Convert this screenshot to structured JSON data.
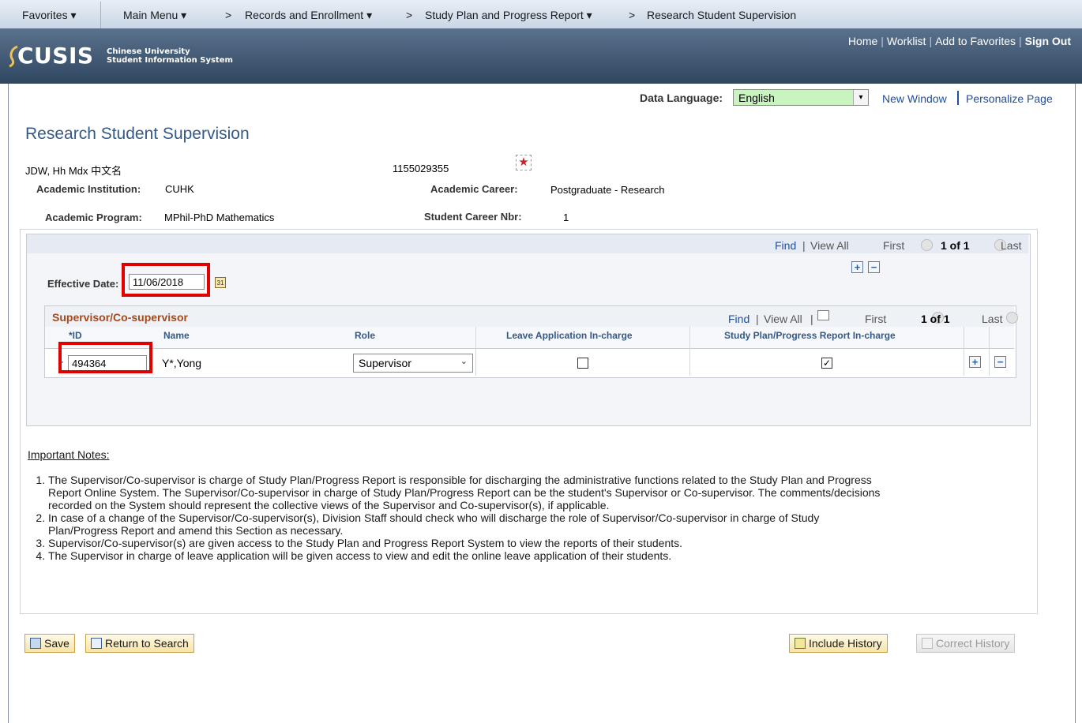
{
  "nav": {
    "favorites": "Favorites ▾",
    "main_menu": "Main Menu ▾",
    "crumbs": [
      "Records and Enrollment ▾",
      "Study Plan and Progress Report ▾",
      "Research Student Supervision"
    ],
    "sep": ">"
  },
  "header": {
    "logo_text": "CUSIS",
    "logo_sub1": "Chinese University",
    "logo_sub2": "Student Information System",
    "links": {
      "home": "Home",
      "worklist": "Worklist",
      "add_fav": "Add to Favorites",
      "signout": "Sign Out"
    }
  },
  "toolbar": {
    "data_language_label": "Data Language:",
    "data_language_value": "English",
    "new_window": "New Window",
    "personalize": "Personalize Page"
  },
  "page": {
    "title": "Research Student Supervision",
    "student_name": "JDW, Hh Mdx 中文名",
    "student_id": "1155029355",
    "institution_label": "Academic Institution:",
    "institution_value": "CUHK",
    "career_label": "Academic Career:",
    "career_value": "Postgraduate - Research",
    "program_label": "Academic Program:",
    "program_value": "MPhil-PhD Mathematics",
    "career_nbr_label": "Student Career Nbr:",
    "career_nbr_value": "1"
  },
  "outer_nav": {
    "find": "Find",
    "view_all": "View All",
    "first": "First",
    "count": "1 of 1",
    "last": "Last"
  },
  "effective_date": {
    "label": "Effective Date:",
    "value": "11/06/2018"
  },
  "grid": {
    "title": "Supervisor/Co-supervisor",
    "find": "Find",
    "view_all": "View All",
    "first": "First",
    "count": "1 of 1",
    "last": "Last",
    "columns": {
      "id": "*ID",
      "name": "Name",
      "role": "Role",
      "leave": "Leave Application In-charge",
      "study": "Study Plan/Progress Report In-charge"
    },
    "row": {
      "id": "494364",
      "name": "Y*,Yong",
      "role": "Supervisor",
      "leave_checked": false,
      "study_checked": true
    }
  },
  "notes": {
    "heading": "Important Notes:",
    "items": [
      "The Supervisor/Co-supervisor is charge of Study Plan/Progress Report is responsible for discharging the administrative functions related to the Study Plan and Progress Report Online System. The Supervisor/Co-supervisor in charge of Study Plan/Progress Report can be the student's Supervisor or Co-supervisor. The comments/decisions recorded on the System should represent the collective views of the Supervisor and Co-supervisor(s), if applicable.",
      "In case of a change of the Supervisor/Co-supervisor(s), Division Staff should check who will discharge the role of Supervisor/Co-supervisor in charge of Study Plan/Progress Report and amend this Section as necessary.",
      "Supervisor/Co-supervisor(s) are given access to the Study Plan and Progress Report System to view the reports of their students.",
      "The Supervisor in charge of leave application will be given access to view and edit the online leave application of their students."
    ]
  },
  "buttons": {
    "save": "Save",
    "return": "Return to Search",
    "include_history": "Include History",
    "correct_history": "Correct History"
  }
}
